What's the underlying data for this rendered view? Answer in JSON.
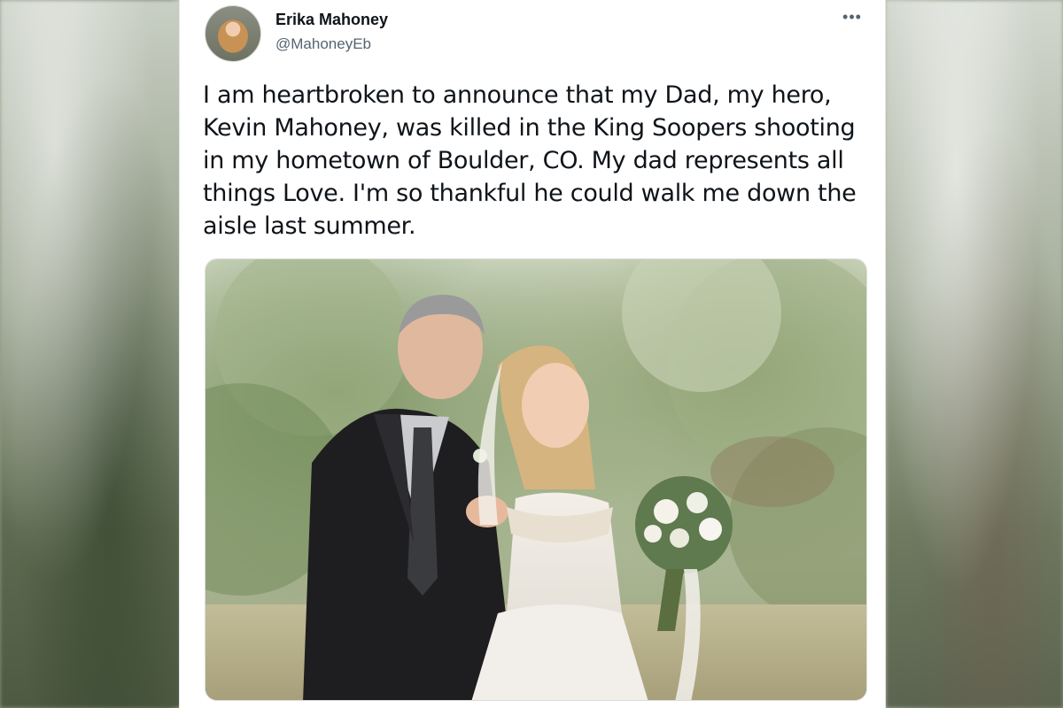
{
  "tweet": {
    "display_name": "Erika Mahoney",
    "handle": "@MahoneyEb",
    "more_icon": "more-horizontal-icon",
    "more_glyph": "•••",
    "text": "I am heartbroken to announce that my Dad, my hero, Kevin Mahoney, was killed in the King Soopers shooting in my hometown of Boulder, CO. My dad represents all things Love. I'm so thankful he could walk me down the aisle last summer."
  },
  "colors": {
    "text_primary": "#0f1419",
    "text_secondary": "#536471",
    "card_background": "#ffffff"
  }
}
